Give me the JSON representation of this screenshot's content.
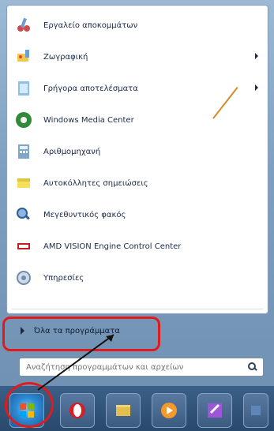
{
  "menu": {
    "items": [
      {
        "label": "Εργαλείο αποκομμάτων",
        "icon": "scissors-icon",
        "has_arrow": false
      },
      {
        "label": "Ζωγραφική",
        "icon": "paint-icon",
        "has_arrow": true
      },
      {
        "label": "Γρήγορα αποτελέσματα",
        "icon": "sticky-notes-icon",
        "has_arrow": true
      },
      {
        "label": "Windows Media Center",
        "icon": "media-center-icon",
        "has_arrow": false
      },
      {
        "label": "Αριθμομηχανή",
        "icon": "calculator-icon",
        "has_arrow": false
      },
      {
        "label": "Αυτοκόλλητες σημειώσεις",
        "icon": "notes-icon",
        "has_arrow": false
      },
      {
        "label": "Μεγεθυντικός φακός",
        "icon": "magnifier-icon",
        "has_arrow": false
      },
      {
        "label": "AMD VISION Engine Control Center",
        "icon": "amd-icon",
        "has_arrow": false
      },
      {
        "label": "Υπηρεσίες",
        "icon": "services-icon",
        "has_arrow": false
      }
    ],
    "all_programs_label": "Όλα τα προγράμματα"
  },
  "search": {
    "placeholder": "Αναζήτηση προγραμμάτων και αρχείων",
    "value": ""
  },
  "taskbar": {
    "icons": [
      {
        "name": "start-button-icon"
      },
      {
        "name": "opera-icon"
      },
      {
        "name": "explorer-icon"
      },
      {
        "name": "media-player-icon"
      },
      {
        "name": "tools-icon"
      },
      {
        "name": "extra-icon"
      }
    ]
  },
  "colors": {
    "highlight_red": "#e11b1b",
    "menu_bg": "#ffffff",
    "taskbar_bg": "#2f4d6b"
  }
}
